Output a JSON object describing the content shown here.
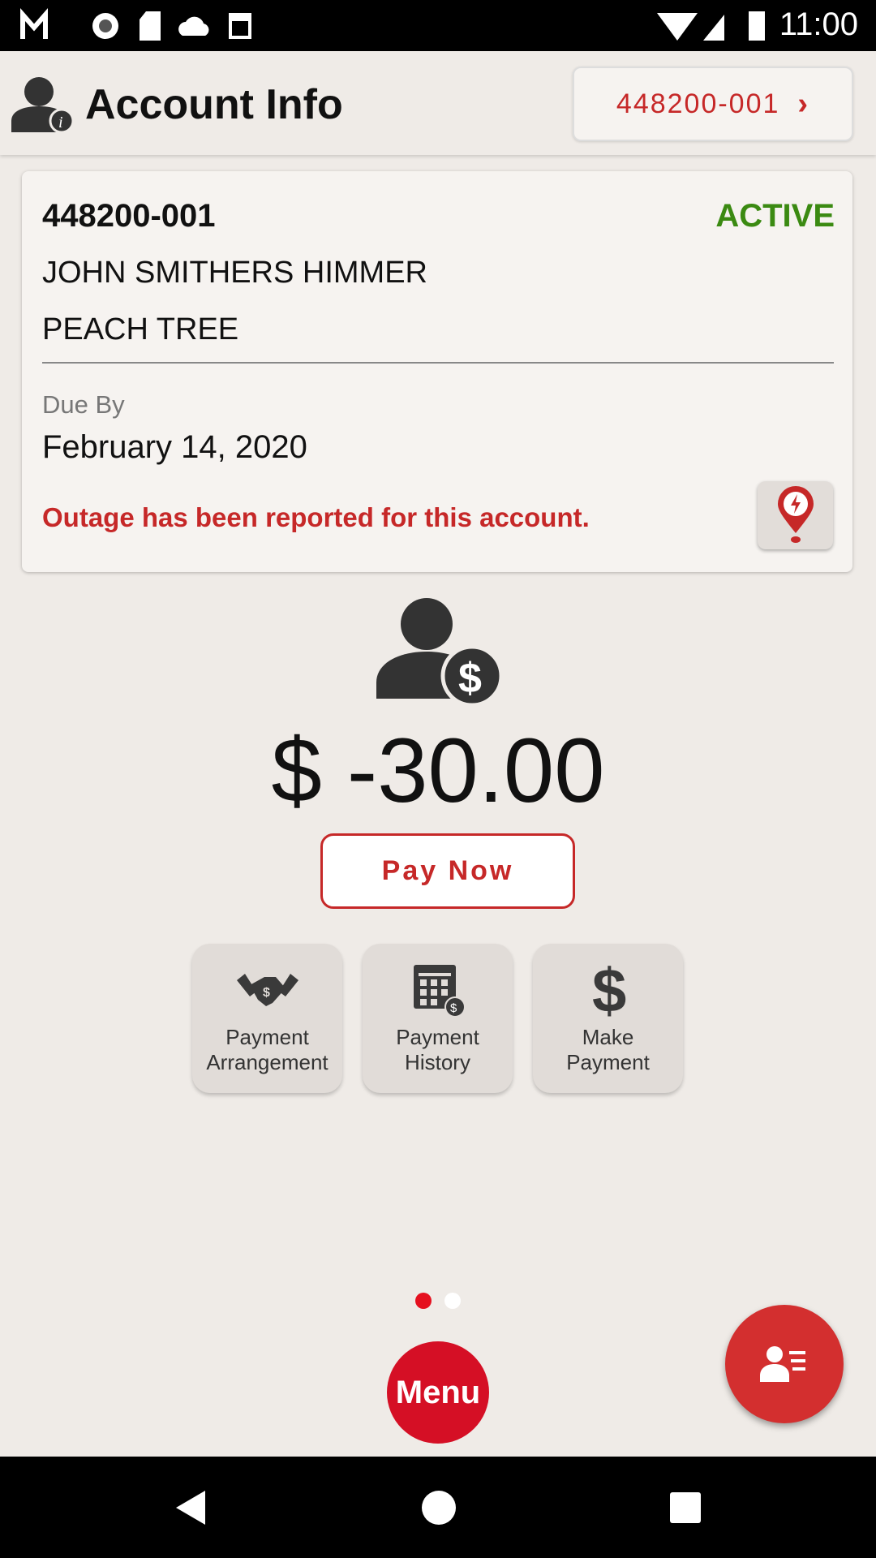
{
  "status_bar": {
    "time": "11:00",
    "icons": [
      "gmail-icon",
      "record-icon",
      "sd-card-icon",
      "cloud-icon",
      "calendar-icon",
      "wifi-icon",
      "signal-icon",
      "battery-icon"
    ]
  },
  "header": {
    "title": "Account Info",
    "account_button": "448200-001"
  },
  "card": {
    "account_number": "448200-001",
    "status": "ACTIVE",
    "name": "JOHN SMITHERS HIMMER",
    "location": "PEACH TREE",
    "due_label": "Due By",
    "due_date": "February 14, 2020",
    "outage_message": "Outage has been reported for this account."
  },
  "balance": {
    "amount": "$ -30.00",
    "pay_now": "Pay Now"
  },
  "actions": [
    {
      "line1": "Payment",
      "line2": "Arrangement"
    },
    {
      "line1": "Payment",
      "line2": "History"
    },
    {
      "line1": "Make",
      "line2": "Payment"
    }
  ],
  "pager": {
    "page": 1,
    "total": 2
  },
  "menu_label": "Menu",
  "colors": {
    "accent": "#c62828",
    "active": "#3b8a12",
    "background": "#efebe7"
  }
}
